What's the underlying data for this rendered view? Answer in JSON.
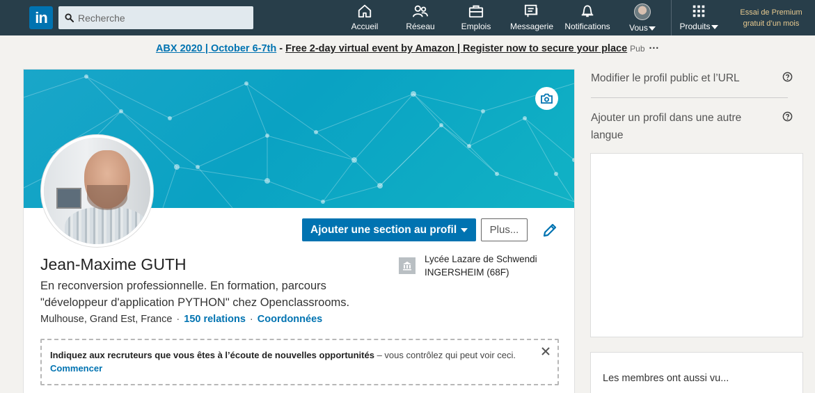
{
  "nav": {
    "logo": "in",
    "search_placeholder": "Recherche",
    "items": [
      {
        "label": "Accueil",
        "icon": "home-icon"
      },
      {
        "label": "Réseau",
        "icon": "network-icon"
      },
      {
        "label": "Emplois",
        "icon": "briefcase-icon"
      },
      {
        "label": "Messagerie",
        "icon": "messaging-icon"
      },
      {
        "label": "Notifications",
        "icon": "bell-icon"
      },
      {
        "label": "Vous",
        "icon": "avatar"
      },
      {
        "label": "Produits",
        "icon": "grid-icon"
      }
    ],
    "premium": [
      "Essai de Premium",
      "gratuit d’un mois"
    ]
  },
  "ad": {
    "link_text": "ABX 2020 | October 6-7th",
    "separator": " - ",
    "text": "Free 2-day virtual event by Amazon | Register now to secure your place",
    "tag": "Pub",
    "more": "···"
  },
  "profile": {
    "name": "Jean-Maxime GUTH",
    "headline": "En reconversion professionnelle. En formation, parcours \"développeur d'application PYTHON\" chez Openclassrooms.",
    "location": "Mulhouse, Grand Est, France",
    "connections": "150 relations",
    "contact": "Coordonnées",
    "dot": "·",
    "add_section_label": "Ajouter une section au profil",
    "more_label": "Plus...",
    "school_line1": "Lycée Lazare de Schwendi",
    "school_line2": "INGERSHEIM (68F)"
  },
  "notice": {
    "strong": "Indiquez aux recruteurs que vous êtes à l’écoute de nouvelles opportunités",
    "dash": " – ",
    "light": "vous contrôlez qui peut voir ceci.",
    "action": "Commencer"
  },
  "sidebar": {
    "edit_public_profile": "Modifier le profil public et l’URL",
    "add_language_profile": "Ajouter un profil dans une autre langue",
    "also_viewed": "Les membres ont aussi vu..."
  },
  "colors": {
    "nav_bg": "#283e4a",
    "brand_blue": "#0073b1",
    "premium_gold": "#e7c98f",
    "cover": "#0aa2c3"
  }
}
